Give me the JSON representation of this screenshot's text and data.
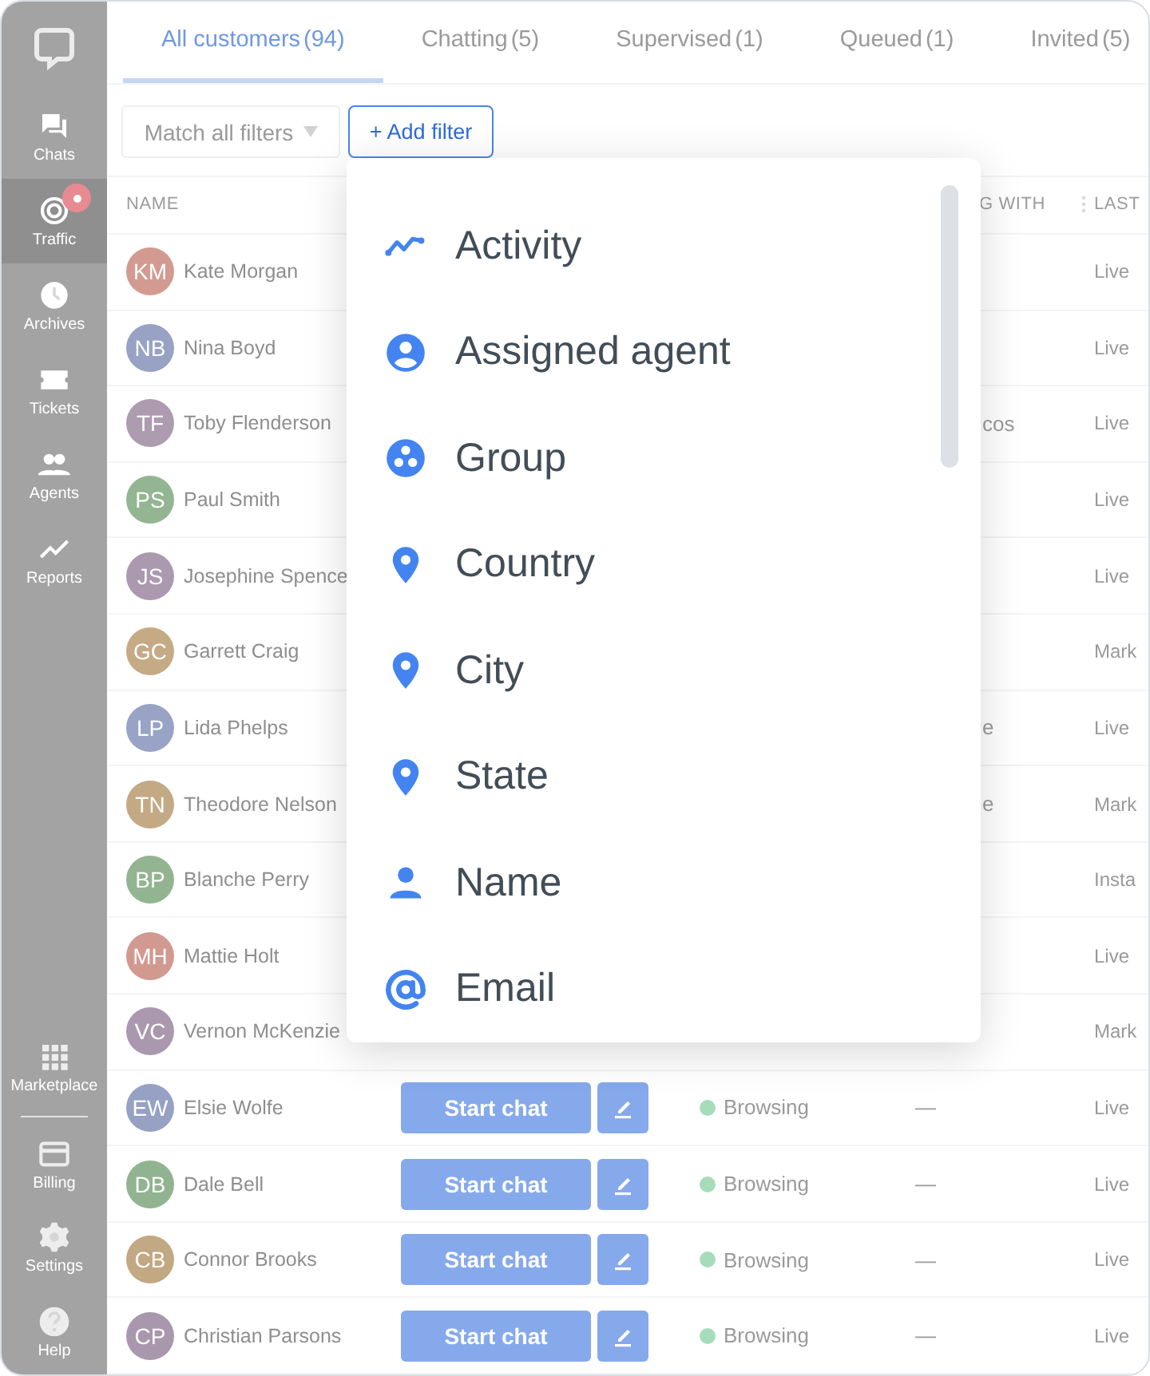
{
  "sidebar": {
    "items": [
      {
        "kind": "chats",
        "label": "Chats",
        "selected": false,
        "alert": false
      },
      {
        "kind": "traffic",
        "label": "Traffic",
        "selected": true,
        "alert": true
      },
      {
        "kind": "archives",
        "label": "Archives",
        "selected": false,
        "alert": false
      },
      {
        "kind": "tickets",
        "label": "Tickets",
        "selected": false,
        "alert": false
      },
      {
        "kind": "agents",
        "label": "Agents",
        "selected": false,
        "alert": false
      },
      {
        "kind": "reports",
        "label": "Reports",
        "selected": false,
        "alert": false
      }
    ],
    "bottom_items": [
      {
        "kind": "marketplace",
        "label": "Marketplace"
      },
      {
        "kind": "billing",
        "label": "Billing"
      },
      {
        "kind": "settings",
        "label": "Settings"
      },
      {
        "kind": "help",
        "label": "Help"
      }
    ]
  },
  "tabs": [
    {
      "label": "All customers",
      "count": "(94)",
      "selected": true
    },
    {
      "label": "Chatting",
      "count": "(5)",
      "selected": false
    },
    {
      "label": "Supervised",
      "count": "(1)",
      "selected": false
    },
    {
      "label": "Queued",
      "count": "(1)",
      "selected": false
    },
    {
      "label": "Invited",
      "count": "(5)",
      "selected": false
    }
  ],
  "filters": {
    "match": "Match all filters",
    "add_button": "+ Add filter"
  },
  "table": {
    "columns": {
      "name": "NAME",
      "chatting": "G WITH",
      "last": "LAST"
    },
    "rows": [
      {
        "kind": "covered",
        "initials": "KM",
        "name": "Kate Morgan",
        "color": "#d39a91",
        "chatting_with": "",
        "last": "Live"
      },
      {
        "kind": "covered",
        "initials": "NB",
        "name": "Nina Boyd",
        "color": "#97a2c4",
        "chatting_with": "",
        "last": "Live"
      },
      {
        "kind": "covered",
        "initials": "TF",
        "name": "Toby Flenderson",
        "color": "#ad9bb0",
        "chatting_with": "cos",
        "last": "Live"
      },
      {
        "kind": "covered",
        "initials": "PS",
        "name": "Paul Smith",
        "color": "#94b592",
        "chatting_with": "",
        "last": "Live"
      },
      {
        "kind": "covered",
        "initials": "JS",
        "name": "Josephine Spence",
        "color": "#ab9aaf",
        "chatting_with": "",
        "last": "Live"
      },
      {
        "kind": "covered",
        "initials": "GC",
        "name": "Garrett Craig",
        "color": "#c5aa86",
        "chatting_with": "",
        "last": "Mark"
      },
      {
        "kind": "covered",
        "initials": "LP",
        "name": "Lida Phelps",
        "color": "#98a3c5",
        "chatting_with": "e",
        "last": "Live"
      },
      {
        "kind": "covered",
        "initials": "TN",
        "name": "Theodore Nelson",
        "color": "#c4a985",
        "chatting_with": "e",
        "last": "Mark"
      },
      {
        "kind": "covered",
        "initials": "BP",
        "name": "Blanche Perry",
        "color": "#93b491",
        "chatting_with": "",
        "last": "Insta"
      },
      {
        "kind": "covered",
        "initials": "MH",
        "name": "Mattie Holt",
        "color": "#d29990",
        "chatting_with": "",
        "last": "Live"
      },
      {
        "kind": "covered",
        "initials": "VC",
        "name": "Vernon McKenzie",
        "color": "#aa99ae",
        "chatting_with": "",
        "last": "Mark"
      },
      {
        "kind": "full",
        "initials": "EW",
        "name": "Elsie Wolfe",
        "color": "#96a1c3",
        "button": "Start chat",
        "status": "Browsing",
        "chatting_with": "—",
        "last": "Live"
      },
      {
        "kind": "full",
        "initials": "DB",
        "name": "Dale Bell",
        "color": "#92b390",
        "button": "Start chat",
        "status": "Browsing",
        "chatting_with": "—",
        "last": "Live"
      },
      {
        "kind": "full",
        "initials": "CB",
        "name": "Connor Brooks",
        "color": "#c3a884",
        "button": "Start chat",
        "status": "Browsing",
        "chatting_with": "—",
        "last": "Live"
      },
      {
        "kind": "full",
        "initials": "CP",
        "name": "Christian Parsons",
        "color": "#a998ad",
        "button": "Start chat",
        "status": "Browsing",
        "chatting_with": "—",
        "last": "Live"
      }
    ]
  },
  "filter_menu": {
    "items": [
      {
        "kind": "activity",
        "label": "Activity"
      },
      {
        "kind": "agent",
        "label": "Assigned agent"
      },
      {
        "kind": "group",
        "label": "Group"
      },
      {
        "kind": "location",
        "label": "Country"
      },
      {
        "kind": "location",
        "label": "City"
      },
      {
        "kind": "location",
        "label": "State"
      },
      {
        "kind": "person",
        "label": "Name"
      },
      {
        "kind": "email",
        "label": "Email"
      }
    ]
  }
}
